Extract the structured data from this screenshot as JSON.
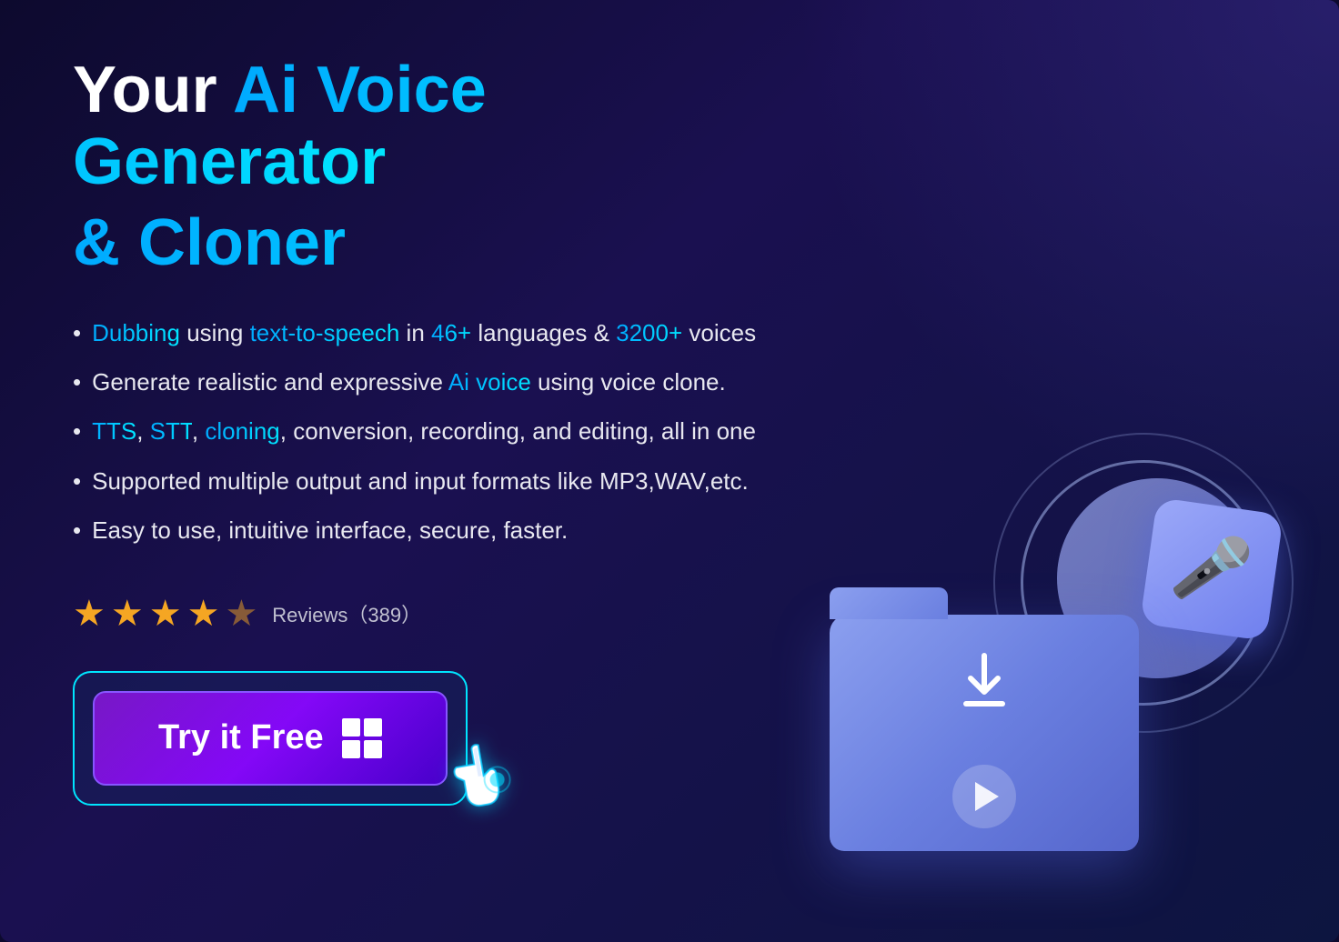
{
  "page": {
    "background_color": "#0d0a2e",
    "accent_color": "#00c8ff"
  },
  "title": {
    "prefix": "Your ",
    "highlight": "Ai Voice Generator",
    "line2": "& Cloner"
  },
  "features": [
    {
      "text": "Dubbing using text-to-speech in 46+ languages & 3200+ voices",
      "keywords": [
        "Dubbing",
        "text-to-speech",
        "46+",
        "3200+"
      ]
    },
    {
      "text": "Generate realistic and expressive Ai voice using voice clone.",
      "keywords": [
        "Ai voice"
      ]
    },
    {
      "text": "TTS, STT, cloning, conversion, recording, and editing, all in one",
      "keywords": [
        "TTS",
        "STT",
        "cloning"
      ]
    },
    {
      "text": "Supported multiple output and input formats like MP3,WAV,etc.",
      "keywords": []
    },
    {
      "text": "Easy to use, intuitive interface, secure, faster.",
      "keywords": []
    }
  ],
  "reviews": {
    "rating": 4.5,
    "label": "Reviews",
    "count": "389",
    "full_text": "Reviews（389）"
  },
  "cta": {
    "button_label": "Try it Free",
    "icon": "windows"
  }
}
